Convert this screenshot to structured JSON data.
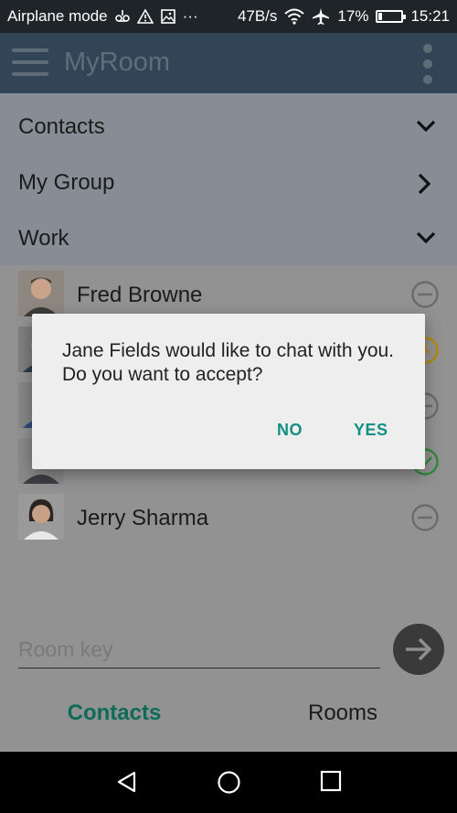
{
  "status_bar": {
    "mode": "Airplane mode",
    "speed": "47B/s",
    "battery": "17%",
    "time": "15:21",
    "icons": [
      "voicemail-icon",
      "warning-icon",
      "image-icon",
      "more-dots",
      "wifi-icon",
      "airplane-icon",
      "battery-icon"
    ]
  },
  "app_bar": {
    "title": "MyRoom",
    "menu_icon": "hamburger-icon",
    "overflow_icon": "more-vertical-icon"
  },
  "groups": [
    {
      "label": "Contacts",
      "state": "expanded"
    },
    {
      "label": "My Group",
      "state": "collapsed"
    },
    {
      "label": "Work",
      "state": "expanded"
    }
  ],
  "contacts": [
    {
      "name": "Fred Browne",
      "status": "offline"
    },
    {
      "name": "",
      "status": "away"
    },
    {
      "name": "",
      "status": "offline"
    },
    {
      "name": "",
      "status": "online"
    },
    {
      "name": "Jerry Sharma",
      "status": "offline"
    }
  ],
  "status_colors": {
    "offline": "#6b6b6b",
    "away": "#b58a00",
    "online": "#2e8b3d"
  },
  "room_key": {
    "placeholder": "Room key",
    "value": ""
  },
  "tabs": {
    "contacts": "Contacts",
    "rooms": "Rooms",
    "active": "Contacts"
  },
  "dialog": {
    "message": "Jane Fields would like to chat with you.  Do you want to accept?",
    "no_label": "NO",
    "yes_label": "YES"
  },
  "colors": {
    "accent": "#138f83",
    "app_bar": "#324556",
    "status_bar": "#1f2429"
  }
}
